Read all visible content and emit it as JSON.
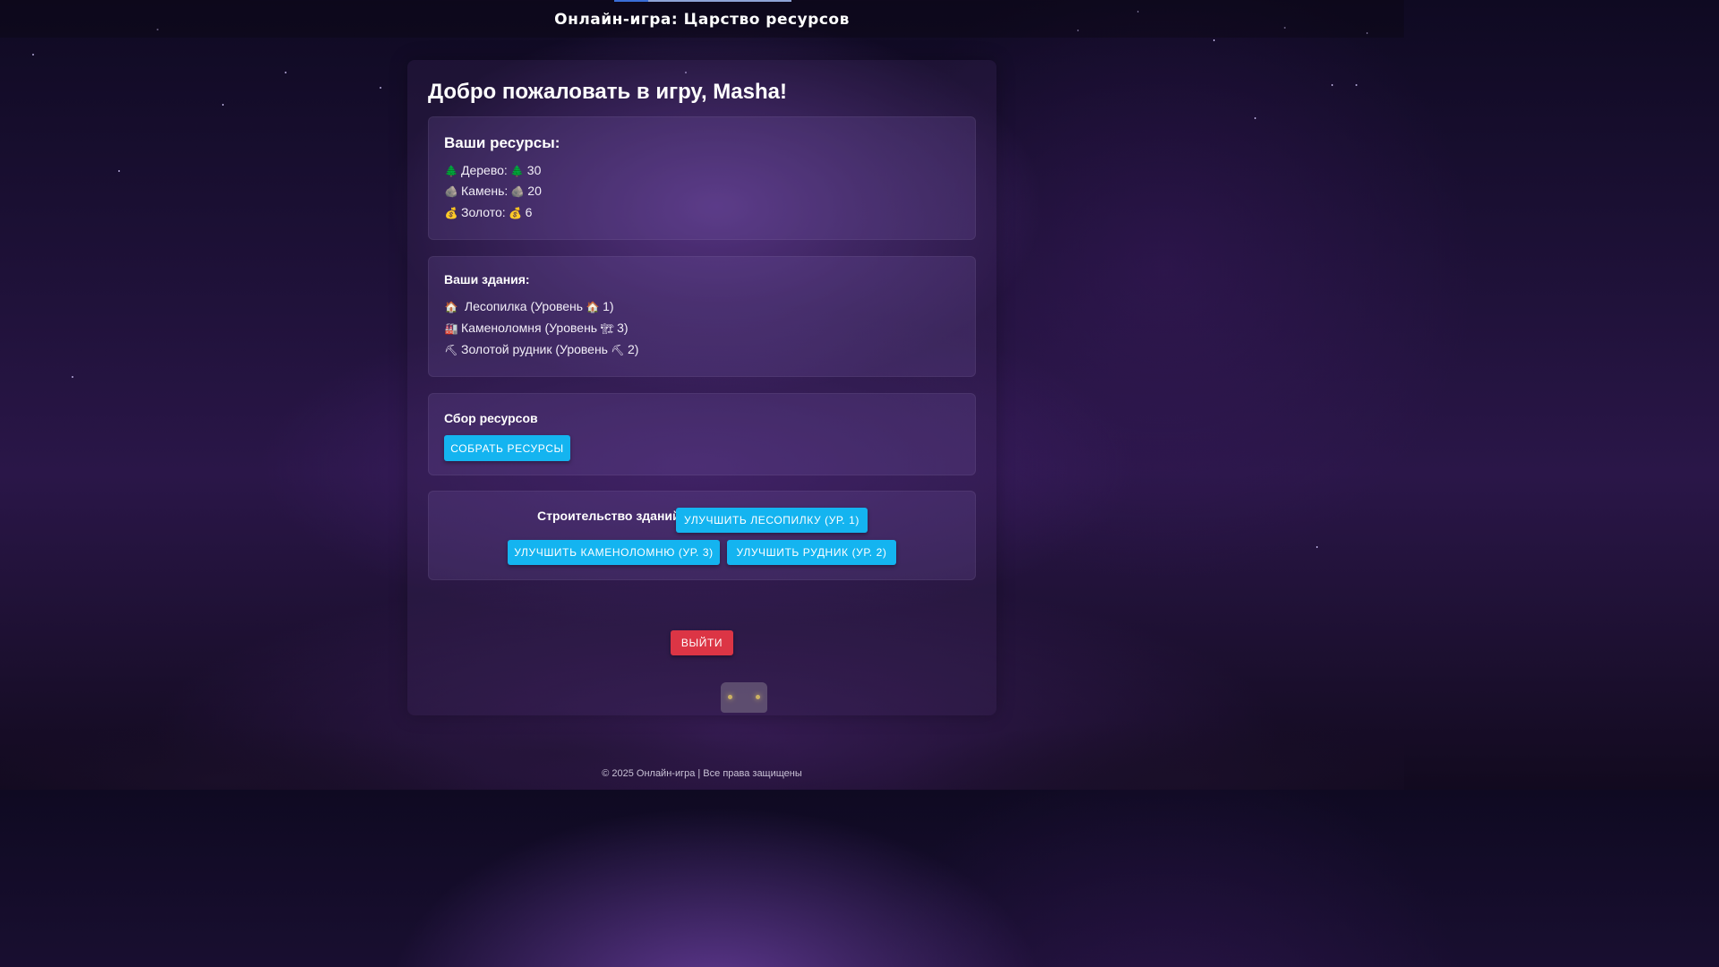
{
  "header": {
    "title": "Онлайн-игра: Царство ресурсов"
  },
  "welcome": "Добро пожаловать в игру, Masha!",
  "resources": {
    "title": "Ваши ресурсы:",
    "items": [
      {
        "icon": "tree-icon",
        "glyph": "🌲",
        "label": "Дерево:",
        "value": "30"
      },
      {
        "icon": "rock-icon",
        "glyph": "🪨",
        "label": "Камень:",
        "value": "20"
      },
      {
        "icon": "money-bag-icon",
        "glyph": "💰",
        "label": "Золото:",
        "value": "6"
      }
    ]
  },
  "buildings": {
    "title": "Ваши здания:",
    "items": [
      {
        "icon": "house-icon",
        "glyph": "🏠",
        "name": "Лесопилка (Уровень",
        "level": "1)"
      },
      {
        "icon": "factory-icon",
        "glyph": "🏭",
        "glyph2": "🏗",
        "name": "Каменоломня (Уровень",
        "level": "3)"
      },
      {
        "icon": "pickaxe-icon",
        "glyph": "⛏",
        "name": "Золотой рудник (Уровень",
        "level": "2)"
      }
    ]
  },
  "collect": {
    "title": "Сбор ресурсов",
    "button": "Собрать ресурсы"
  },
  "build": {
    "title": "Строительство зданий",
    "upgrade_sawmill": "Улучшить лесопилку (ур. 1)",
    "upgrade_quarry": "Улучшить каменоломню (ур. 3)",
    "upgrade_mine": "Улучшить рудник (ур. 2)"
  },
  "logout": "Выйти",
  "footer": "© 2025 Онлайн-игра | Все права защищены",
  "colors": {
    "accent": "#14b4f0",
    "danger": "#dc3545"
  }
}
